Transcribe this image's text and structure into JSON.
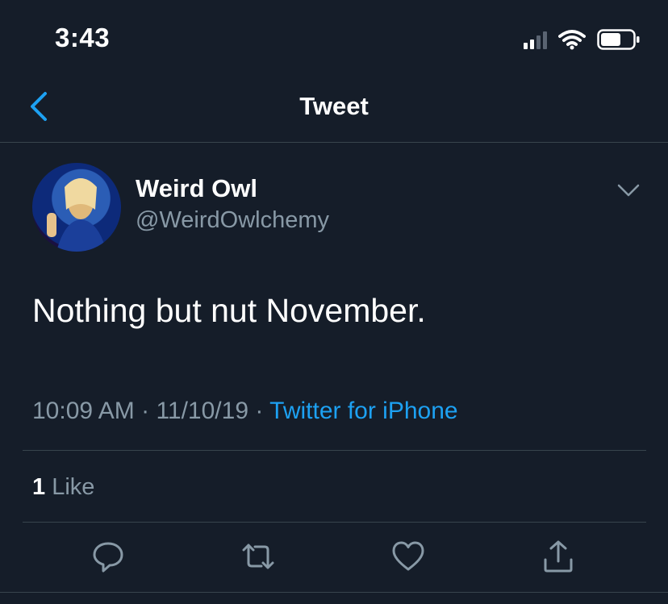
{
  "status_bar": {
    "time": "3:43"
  },
  "nav": {
    "title": "Tweet"
  },
  "tweet": {
    "display_name": "Weird Owl",
    "handle": "@WeirdOwlchemy",
    "text": "Nothing but nut November.",
    "time": "10:09 AM",
    "separator": "·",
    "date": "11/10/19",
    "source": "Twitter for iPhone"
  },
  "engagement": {
    "like_count": "1",
    "like_label": "Like"
  },
  "colors": {
    "background": "#151d29",
    "accent": "#1da1f2",
    "secondary_text": "#8899a6",
    "divider": "#38444d"
  },
  "icons": {
    "back": "chevron-left-icon",
    "more": "chevron-down-icon",
    "reply": "reply-icon",
    "retweet": "retweet-icon",
    "like": "heart-icon",
    "share": "share-icon"
  }
}
